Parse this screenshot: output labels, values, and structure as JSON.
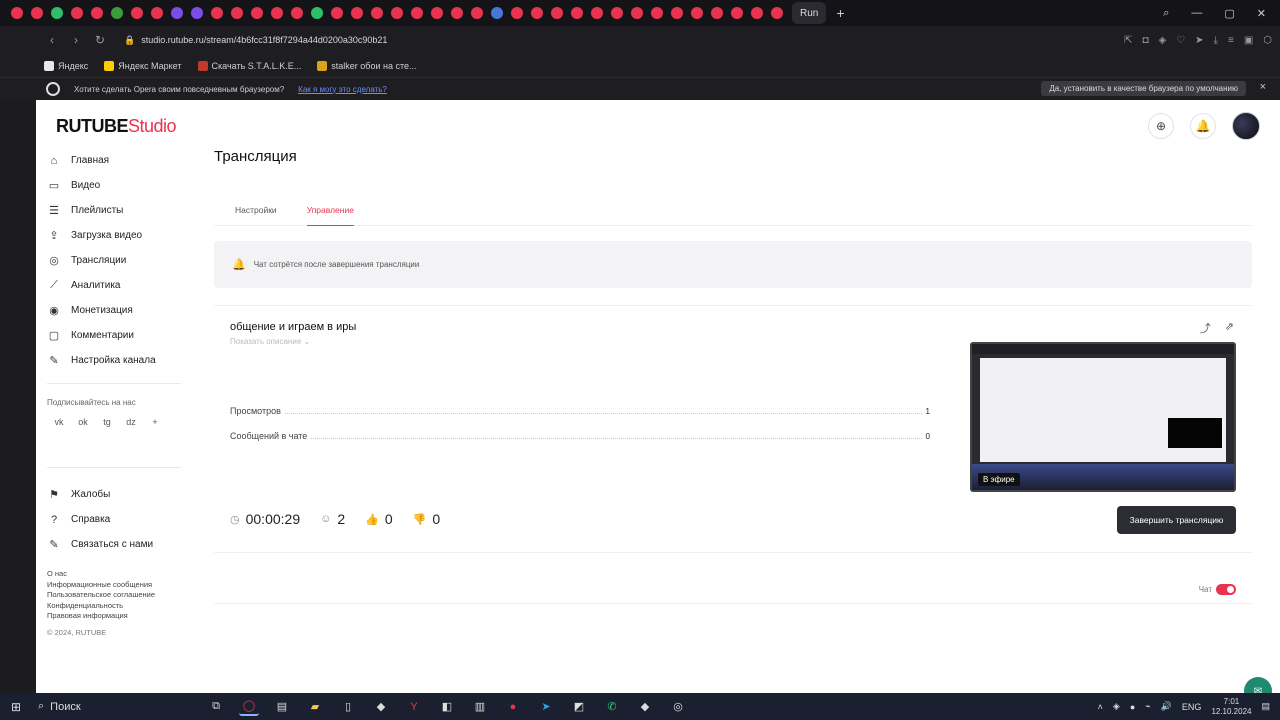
{
  "browser": {
    "tab_favicon_colors": [
      "#e8344e",
      "#e8344e",
      "#2dbf6a",
      "#e8344e",
      "#e8344e",
      "#3a9d3a",
      "#e8344e",
      "#e8344e",
      "#7b4ce8",
      "#7b4ce8",
      "#e8344e",
      "#e8344e",
      "#e8344e",
      "#e8344e",
      "#e8344e",
      "#2dbf6a",
      "#e8344e",
      "#e8344e",
      "#e8344e",
      "#e8344e",
      "#e8344e",
      "#e8344e",
      "#e8344e",
      "#e8344e",
      "#4a76d8",
      "#e8344e",
      "#e8344e",
      "#e8344e",
      "#e8344e",
      "#e8344e",
      "#e8344e",
      "#e8344e",
      "#e8344e",
      "#e8344e",
      "#e8344e",
      "#e8344e",
      "#e8344e",
      "#e8344e",
      "#e8344e"
    ],
    "active_tab_label": "Run",
    "url": "studio.rutube.ru/stream/4b6fcc31f8f7294a44d0200a30c90b21",
    "bookmarks": [
      {
        "label": "Яндекс",
        "color": "#e8e8e8"
      },
      {
        "label": "Яндекс Маркет",
        "color": "#ffcc00"
      },
      {
        "label": "Скачать S.T.A.L.K.E...",
        "color": "#c0392b"
      },
      {
        "label": "stalker обои на сте...",
        "color": "#d9a21a"
      }
    ],
    "default_bar": {
      "text": "Хотите сделать Opera своим повседневным браузером?",
      "link": "Как я могу это сделать?",
      "button": "Да, установить в качестве браузера по умолчанию",
      "close": "×"
    }
  },
  "app": {
    "logo_main": "RUTUBE",
    "logo_sub": "Studio",
    "page_title": "Трансляция",
    "sidebar": {
      "items": [
        {
          "label": "Главная",
          "icon": "home-icon",
          "glyph": "⌂"
        },
        {
          "label": "Видео",
          "icon": "video-icon",
          "glyph": "▭"
        },
        {
          "label": "Плейлисты",
          "icon": "playlist-icon",
          "glyph": "☰"
        },
        {
          "label": "Загрузка видео",
          "icon": "upload-icon",
          "glyph": "⇪"
        },
        {
          "label": "Трансляции",
          "icon": "broadcast-icon",
          "glyph": "◎"
        },
        {
          "label": "Аналитика",
          "icon": "analytics-icon",
          "glyph": "⟋"
        },
        {
          "label": "Монетизация",
          "icon": "money-icon",
          "glyph": "◉"
        },
        {
          "label": "Комментарии",
          "icon": "comment-icon",
          "glyph": "▢"
        },
        {
          "label": "Настройка канала",
          "icon": "wand-icon",
          "glyph": "✎"
        }
      ],
      "follow_label": "Подписывайтесь на нас",
      "socials": [
        "vk",
        "ok",
        "tg",
        "dz",
        "+"
      ],
      "help_items": [
        {
          "label": "Жалобы",
          "icon": "flag-icon",
          "glyph": "⚑"
        },
        {
          "label": "Справка",
          "icon": "help-icon",
          "glyph": "?"
        },
        {
          "label": "Связаться с нами",
          "icon": "contact-icon",
          "glyph": "✎"
        }
      ],
      "footer_links": [
        "О нас",
        "Информационные сообщения",
        "Пользовательское соглашение",
        "Конфиденциальность",
        "Правовая информация"
      ],
      "copyright": "© 2024, RUTUBE"
    },
    "tabs": [
      "Настройки",
      "Управление"
    ],
    "alert_text": "Чат сотрётся после завершения трансляции",
    "stream": {
      "title": "общение и играем в иры",
      "show_description": "Показать описание  ⌄",
      "views_label": "Просмотров",
      "views_value": "1",
      "messages_label": "Сообщений в чате",
      "messages_value": "0",
      "duration": "00:00:29",
      "viewers": "2",
      "likes": "0",
      "dislikes": "0",
      "live_label": "В эфире",
      "end_button": "Завершить трансляцию"
    },
    "chat_label": "Чат",
    "chat_enabled": true
  },
  "taskbar": {
    "search": "Поиск",
    "lang": "ENG",
    "time": "7:01",
    "date": "12.10.2024"
  }
}
